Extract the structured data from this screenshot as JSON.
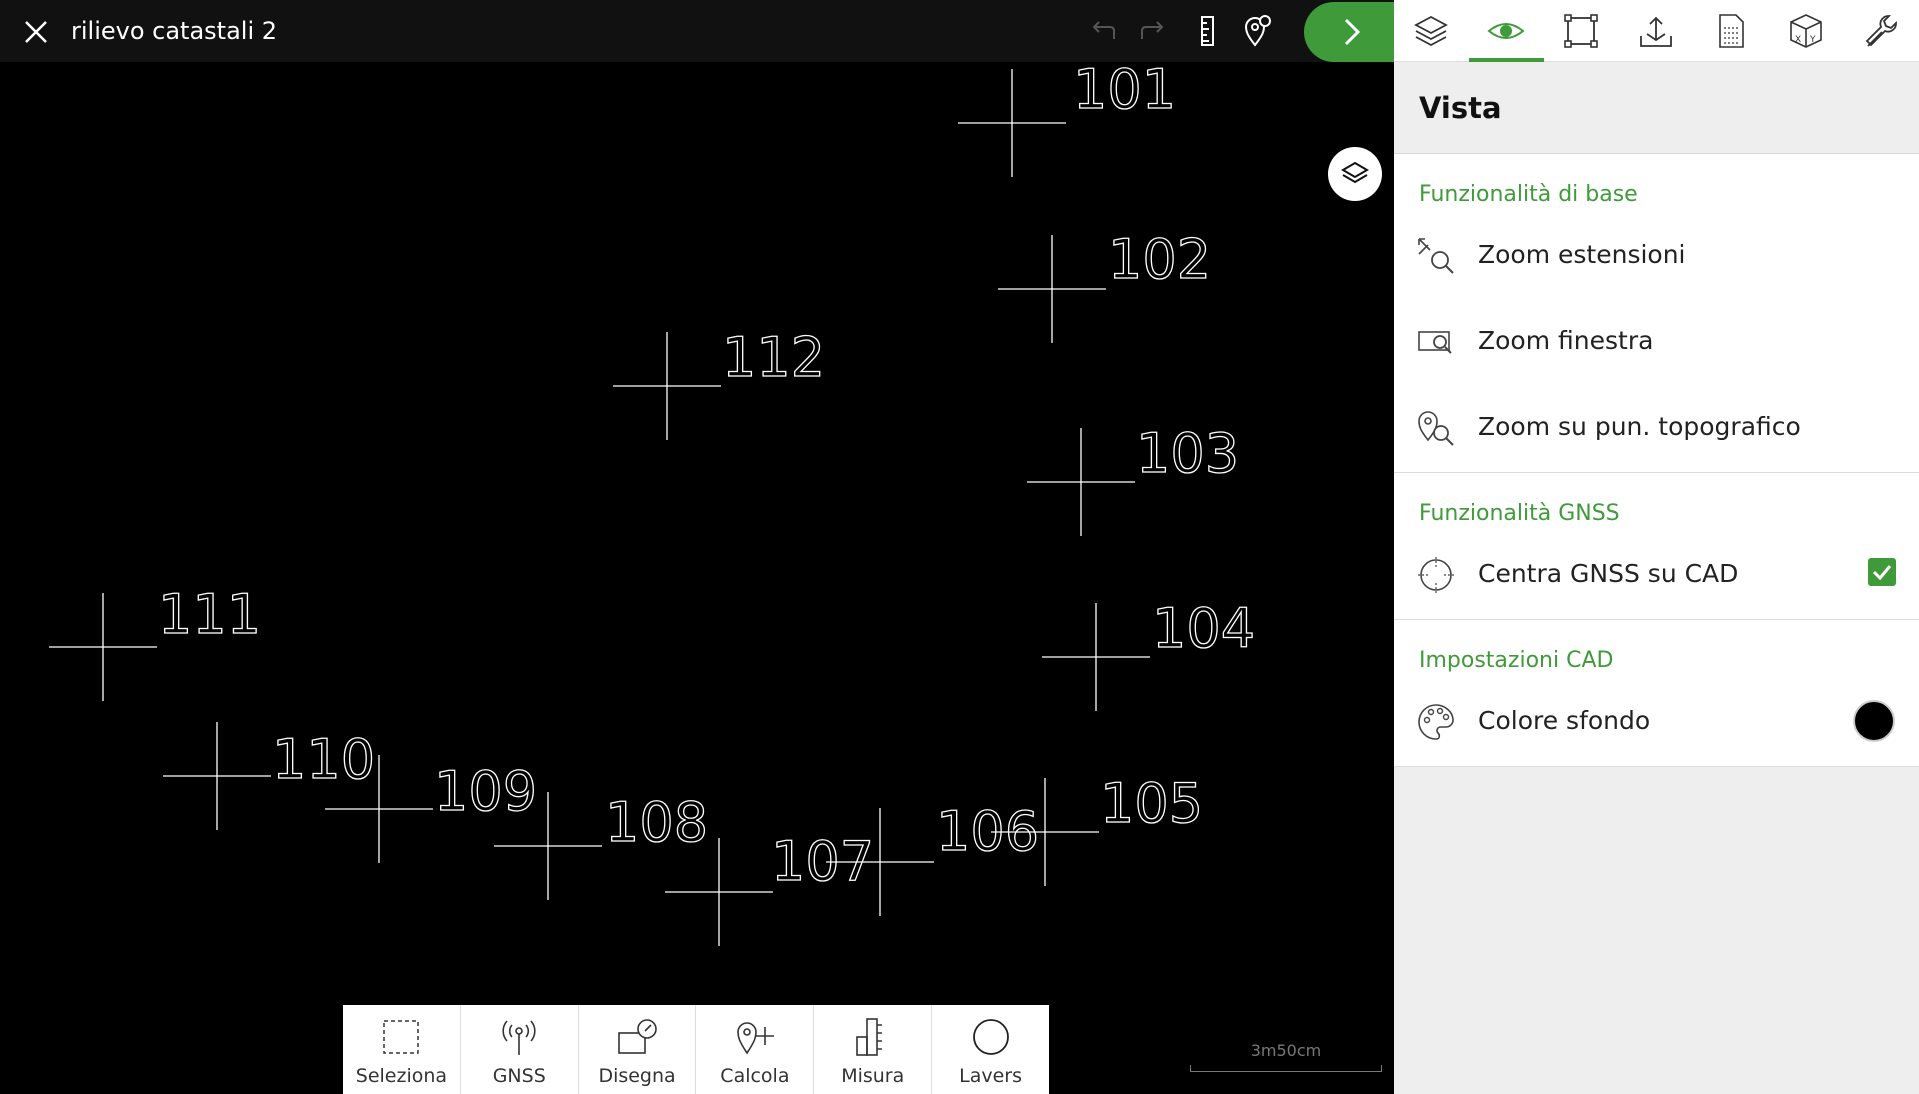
{
  "topbar": {
    "title": "rilievo catastali 2"
  },
  "canvas": {
    "points": [
      {
        "label": "101"
      },
      {
        "label": "102"
      },
      {
        "label": "103"
      },
      {
        "label": "104"
      },
      {
        "label": "105"
      },
      {
        "label": "106"
      },
      {
        "label": "107"
      },
      {
        "label": "108"
      },
      {
        "label": "109"
      },
      {
        "label": "110"
      },
      {
        "label": "111"
      },
      {
        "label": "112"
      }
    ],
    "scale_label": "3m50cm"
  },
  "toolbar": {
    "items": [
      {
        "label": "Seleziona",
        "icon": "dashed-select-icon"
      },
      {
        "label": "GNSS",
        "icon": "antenna-icon"
      },
      {
        "label": "Disegna",
        "icon": "draw-icon"
      },
      {
        "label": "Calcola",
        "icon": "pin-plus-icon"
      },
      {
        "label": "Misura",
        "icon": "ruler-icon"
      },
      {
        "label": "Lavers",
        "icon": "circle-icon"
      }
    ]
  },
  "panel": {
    "title": "Vista",
    "sections": [
      {
        "title": "Funzionalità di base",
        "items": [
          {
            "label": "Zoom estensioni",
            "icon": "zoom-extents-icon"
          },
          {
            "label": "Zoom finestra",
            "icon": "zoom-window-icon"
          },
          {
            "label": "Zoom su pun. topografico",
            "icon": "zoom-point-icon"
          }
        ]
      },
      {
        "title": "Funzionalità GNSS",
        "items": [
          {
            "label": "Centra GNSS su CAD",
            "icon": "crosshair-icon",
            "checked": true
          }
        ]
      },
      {
        "title": "Impostazioni CAD",
        "items": [
          {
            "label": "Colore sfondo",
            "icon": "palette-icon",
            "color": "#000000"
          }
        ]
      }
    ]
  },
  "colors": {
    "accent": "#3f9a3a",
    "background": "#000000"
  }
}
